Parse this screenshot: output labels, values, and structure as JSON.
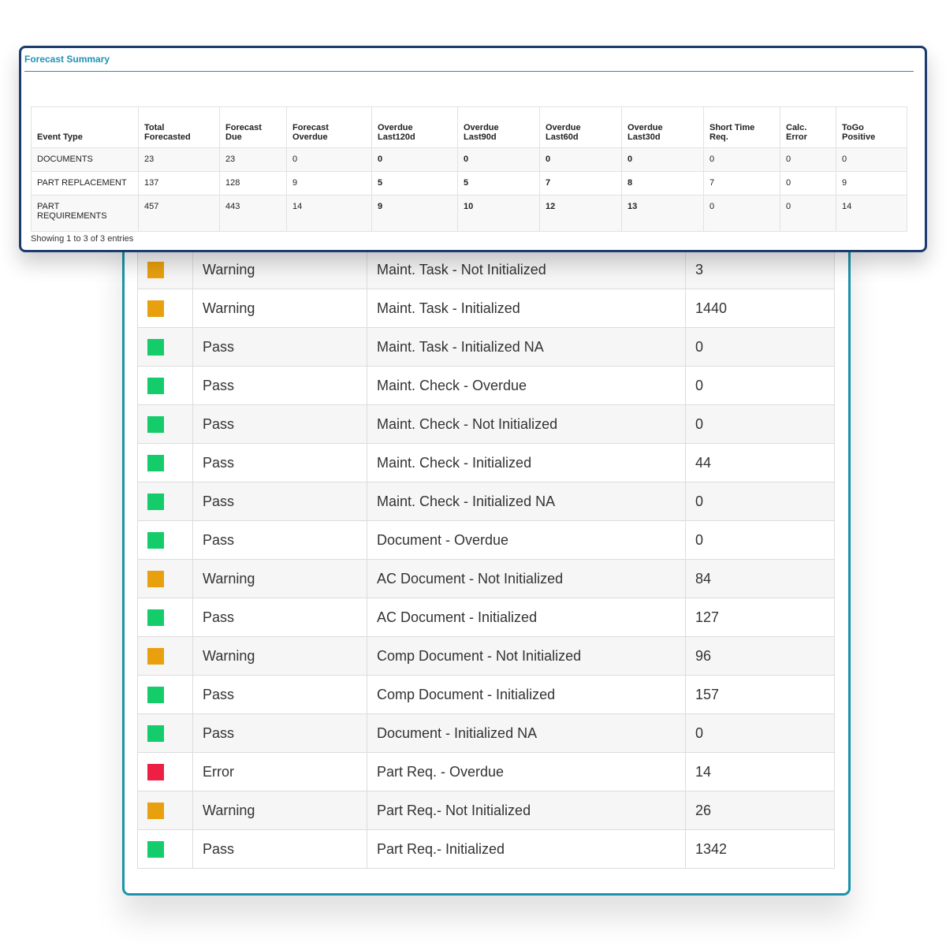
{
  "colors": {
    "pass": "#14cc6a",
    "warning": "#e8a00e",
    "error": "#ee1f45",
    "partial": "#1f5db8"
  },
  "status_rows": [
    {
      "result": "",
      "check": "",
      "count": "",
      "status": "partial"
    },
    {
      "result": "Warning",
      "check": "Maint. Task - Not Initialized",
      "count": "3",
      "status": "warning"
    },
    {
      "result": "Warning",
      "check": "Maint. Task - Initialized",
      "count": "1440",
      "status": "warning"
    },
    {
      "result": "Pass",
      "check": "Maint. Task - Initialized NA",
      "count": "0",
      "status": "pass"
    },
    {
      "result": "Pass",
      "check": "Maint. Check - Overdue",
      "count": "0",
      "status": "pass"
    },
    {
      "result": "Pass",
      "check": "Maint. Check - Not Initialized",
      "count": "0",
      "status": "pass"
    },
    {
      "result": "Pass",
      "check": "Maint. Check - Initialized",
      "count": "44",
      "status": "pass"
    },
    {
      "result": "Pass",
      "check": "Maint. Check - Initialized NA",
      "count": "0",
      "status": "pass"
    },
    {
      "result": "Pass",
      "check": "Document - Overdue",
      "count": "0",
      "status": "pass"
    },
    {
      "result": "Warning",
      "check": "AC Document - Not Initialized",
      "count": "84",
      "status": "warning"
    },
    {
      "result": "Pass",
      "check": "AC Document - Initialized",
      "count": "127",
      "status": "pass"
    },
    {
      "result": "Warning",
      "check": "Comp Document - Not Initialized",
      "count": "96",
      "status": "warning"
    },
    {
      "result": "Pass",
      "check": "Comp Document - Initialized",
      "count": "157",
      "status": "pass"
    },
    {
      "result": "Pass",
      "check": "Document - Initialized NA",
      "count": "0",
      "status": "pass"
    },
    {
      "result": "Error",
      "check": "Part Req. - Overdue",
      "count": "14",
      "status": "error"
    },
    {
      "result": "Warning",
      "check": "Part Req.- Not Initialized",
      "count": "26",
      "status": "warning"
    },
    {
      "result": "Pass",
      "check": "Part Req.- Initialized",
      "count": "1342",
      "status": "pass"
    }
  ],
  "forecast": {
    "title": "Forecast Summary",
    "headers": [
      [
        "",
        "Event Type"
      ],
      [
        "Total",
        "Forecasted"
      ],
      [
        "Forecast",
        "Due"
      ],
      [
        "Forecast",
        "Overdue"
      ],
      [
        "Overdue",
        "Last120d"
      ],
      [
        "Overdue",
        "Last90d"
      ],
      [
        "Overdue",
        "Last60d"
      ],
      [
        "Overdue",
        "Last30d"
      ],
      [
        "Short Time",
        "Req."
      ],
      [
        "Calc.",
        "Error"
      ],
      [
        "ToGo",
        "Positive"
      ]
    ],
    "rows": [
      {
        "event": [
          "DOCUMENTS"
        ],
        "cells": [
          "23",
          "23",
          "0",
          "0",
          "0",
          "0",
          "0",
          "0",
          "0",
          "0"
        ]
      },
      {
        "event": [
          "PART REPLACEMENT"
        ],
        "cells": [
          "137",
          "128",
          "9",
          "5",
          "5",
          "7",
          "8",
          "7",
          "0",
          "9"
        ]
      },
      {
        "event": [
          "PART",
          "REQUIREMENTS"
        ],
        "cells": [
          "457",
          "443",
          "14",
          "9",
          "10",
          "12",
          "13",
          "0",
          "0",
          "14"
        ]
      }
    ],
    "footer": "Showing 1 to 3 of 3 entries"
  }
}
